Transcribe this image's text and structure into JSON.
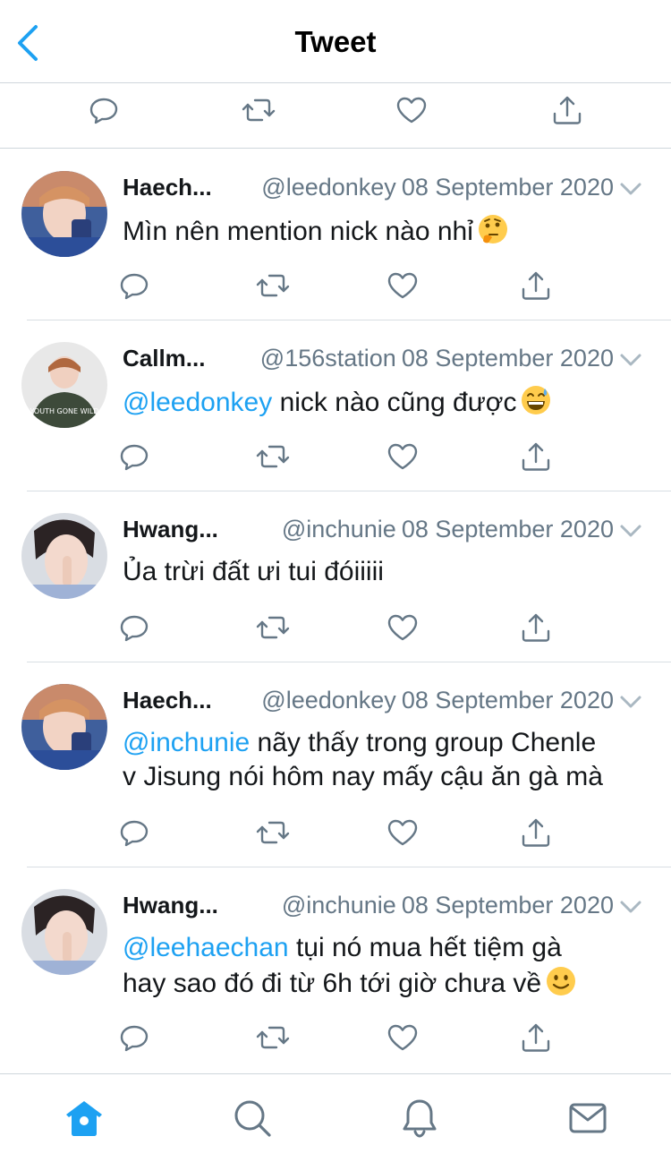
{
  "header": {
    "title": "Tweet",
    "back_icon": "chevron-left-icon"
  },
  "top_actions": [
    "reply-icon",
    "retweet-icon",
    "like-icon",
    "share-icon"
  ],
  "tweets": [
    {
      "name": "Haech...",
      "handle": "@leedonkey",
      "date": "08 September 2020",
      "line1_text": "Mìn nên mention nick nào nhỉ",
      "line1_mention": "",
      "line2": "",
      "emoji": "thinking-face"
    },
    {
      "name": "Callm...",
      "handle": "@156station",
      "date": "08 September 2020",
      "line1_mention": "@leedonkey",
      "line1_text": " nick nào cũng được",
      "line2": "",
      "emoji": "grinning-sweat-face"
    },
    {
      "name": "Hwang...",
      "handle": "@inchunie",
      "date": "08 September 2020",
      "line1_mention": "",
      "line1_text": "Ủa trừi đất ưi tui đóiiiii",
      "line2": "",
      "emoji": ""
    },
    {
      "name": "Haech...",
      "handle": "@leedonkey",
      "date": "08 September 2020",
      "line1_mention": "@inchunie",
      "line1_text": " nãy thấy trong group Chenle",
      "line2": "v Jisung nói hôm nay mấy cậu ăn gà mà",
      "emoji": ""
    },
    {
      "name": "Hwang...",
      "handle": "@inchunie",
      "date": "08 September 2020",
      "line1_mention": "@leehaechan",
      "line1_text": " tụi nó mua hết tiệm gà",
      "line2": "hay sao đó đi từ 6h tới giờ chưa về",
      "emoji": "slightly-smiling-face"
    }
  ],
  "tabbar": [
    "home-icon",
    "search-icon",
    "notifications-icon",
    "messages-icon"
  ],
  "colors": {
    "accent": "#1da1f2",
    "text": "#14171a",
    "secondary": "#657786",
    "icon": "#657786"
  }
}
